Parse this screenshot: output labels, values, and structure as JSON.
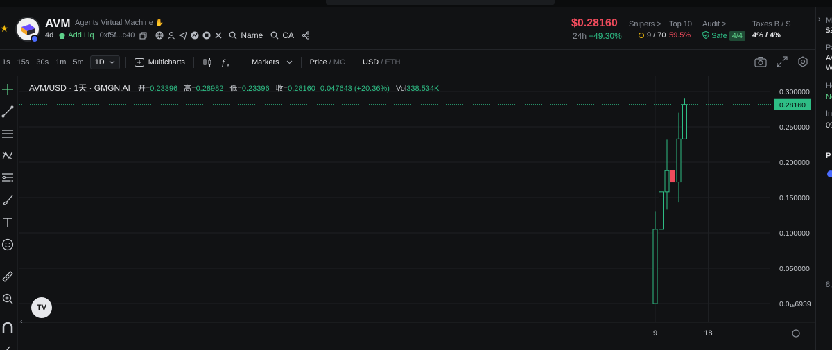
{
  "token": {
    "symbol": "AVM",
    "name": "Agents Virtual Machine",
    "age": "4d",
    "add_liq": "Add Liq",
    "contract_short": "0xf5f...c40",
    "search_name": "Name",
    "search_ca": "CA"
  },
  "price": {
    "value": "$0.28160",
    "period": "24h",
    "change": "+49.30%"
  },
  "stats": {
    "snipers_label": "Snipers >",
    "snipers_value": "9 / 70",
    "top10_label": "Top 10",
    "top10_value": "59.5%",
    "audit_label": "Audit >",
    "audit_value": "Safe",
    "audit_count": "4/4",
    "taxes_label": "Taxes B / S",
    "taxes_value": "4% / 4%"
  },
  "toolbar": {
    "timeframes": [
      "1s",
      "15s",
      "30s",
      "1m",
      "5m"
    ],
    "active_timeframe": "1D",
    "multicharts": "Multicharts",
    "markers": "Markers",
    "price_label": "Price",
    "mc_label": "MC",
    "usd_label": "USD",
    "eth_label": "ETH"
  },
  "legend": {
    "pair": "AVM/USD · 1天 · GMGN.AI",
    "open_k": "开=",
    "open_v": "0.23396",
    "high_k": "高=",
    "high_v": "0.28982",
    "low_k": "低=",
    "low_v": "0.23396",
    "close_k": "收=",
    "close_v": "0.28160",
    "change_v": "0.047643 (+20.36%)",
    "vol_k": "Vol",
    "vol_v": "338.534K"
  },
  "tv_logo": "TV",
  "right_panel": [
    "M",
    "$2",
    "Pa",
    "AV",
    "W",
    "Ho",
    "No",
    "In",
    "0%",
    "P",
    "8,"
  ],
  "colors": {
    "up": "#2ebd85",
    "down": "#f04b5c",
    "price_tag_bg": "#2ebd85",
    "grid": "#1e2023",
    "bg": "#111214"
  },
  "chart_data": {
    "type": "candlestick",
    "y_tick_labels": [
      "0.300000",
      "0.250000",
      "0.200000",
      "0.150000",
      "0.100000",
      "0.050000",
      "0.0₁₆6939"
    ],
    "y_ticks": [
      0.3,
      0.25,
      0.2,
      0.15,
      0.1,
      0.05,
      0.0
    ],
    "ylim": [
      0.0,
      0.3
    ],
    "x_ticks": [
      {
        "label": "9",
        "day": 9
      },
      {
        "label": "18",
        "day": 18
      }
    ],
    "last_price": 0.2816,
    "last_price_label": "0.28160",
    "candles": [
      {
        "day": 9,
        "open": 0.0,
        "high": 0.13,
        "low": 0.0,
        "close": 0.105
      },
      {
        "day": 10,
        "open": 0.105,
        "high": 0.183,
        "low": 0.088,
        "close": 0.158
      },
      {
        "day": 11,
        "open": 0.158,
        "high": 0.232,
        "low": 0.133,
        "close": 0.188
      },
      {
        "day": 12,
        "open": 0.188,
        "high": 0.208,
        "low": 0.158,
        "close": 0.172
      },
      {
        "day": 13,
        "open": 0.172,
        "high": 0.27,
        "low": 0.143,
        "close": 0.233
      },
      {
        "day": 14,
        "open": 0.233,
        "high": 0.29,
        "low": 0.233,
        "close": 0.2816
      }
    ]
  }
}
